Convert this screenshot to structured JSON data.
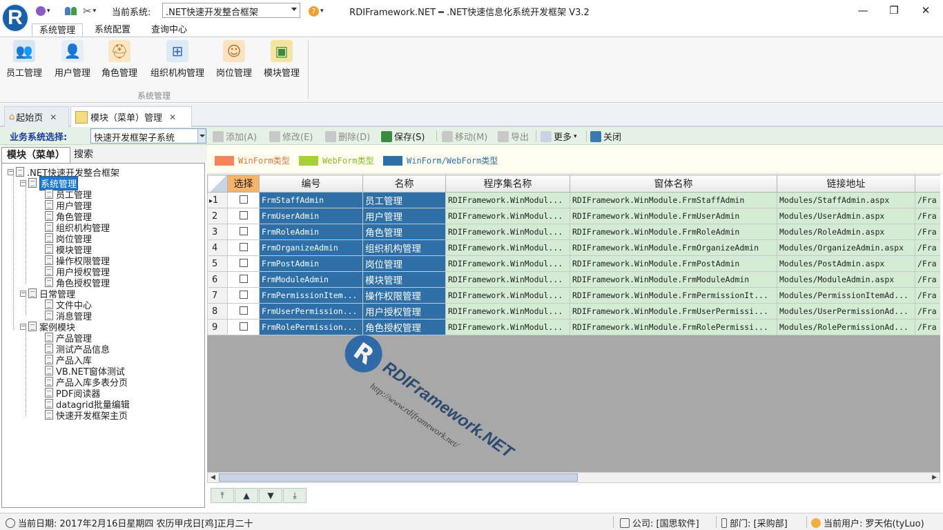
{
  "titlebar": {
    "system_label": "当前系统:",
    "system_value": ".NET快速开发整合框架",
    "window_title": "RDIFramework.NET ━ .NET快速信息化系统开发框架 V3.2",
    "logo_letter": "R",
    "minimize": "—",
    "restore": "❐",
    "close": "✕"
  },
  "ribbon": {
    "tabs": [
      "系统管理",
      "系统配置",
      "查询中心"
    ],
    "buttons": [
      {
        "label": "员工管理",
        "icon": "staff-icon"
      },
      {
        "label": "用户管理",
        "icon": "user-icon"
      },
      {
        "label": "角色管理",
        "icon": "role-icon"
      },
      {
        "label": "组织机构管理",
        "icon": "org-icon"
      },
      {
        "label": "岗位管理",
        "icon": "post-icon"
      },
      {
        "label": "模块管理",
        "icon": "module-icon"
      }
    ],
    "group_label": "系统管理"
  },
  "doctabs": [
    {
      "label": "起始页",
      "close": "✕"
    },
    {
      "label": "模块（菜单）管理",
      "close": "✕"
    }
  ],
  "toolbar": {
    "biz_label": "业务系统选择:",
    "biz_value": "快速开发框架子系统",
    "add": "添加(A)",
    "edit": "修改(E)",
    "delete": "删除(D)",
    "save": "保存(S)",
    "move": "移动(M)",
    "export": "导出",
    "more": "更多",
    "close": "关闭"
  },
  "left_tabs": [
    "模块（菜单）",
    "搜索"
  ],
  "tree": {
    "root": ".NET快速开发整合框架",
    "groups": [
      {
        "label": "系统管理",
        "items": [
          "员工管理",
          "用户管理",
          "角色管理",
          "组织机构管理",
          "岗位管理",
          "模块管理",
          "操作权限管理",
          "用户授权管理",
          "角色授权管理"
        ]
      },
      {
        "label": "日常管理",
        "items": [
          "文件中心",
          "消息管理"
        ]
      },
      {
        "label": "案例模块",
        "items": [
          "产品管理",
          "测试产品信息",
          "产品入库",
          "VB.NET窗体测试",
          "产品入库多表分页",
          "PDF阅读器",
          "datagrid批量编辑",
          "快速开发框架主页"
        ]
      }
    ]
  },
  "legend": [
    {
      "label": "WinForm类型",
      "color": "#f5845a",
      "text_color": "#e8743a"
    },
    {
      "label": "WebForm类型",
      "color": "#a6cf38",
      "text_color": "#8cb820"
    },
    {
      "label": "WinForm/WebForm类型",
      "color": "#2e6fa8",
      "text_color": "#2e6fa8"
    }
  ],
  "grid": {
    "columns": [
      "",
      "选择",
      "编号",
      "名称",
      "程序集名称",
      "窗体名称",
      "链接地址",
      ""
    ],
    "rows": [
      {
        "no": "1",
        "code": "FrmStaffAdmin",
        "name": "员工管理",
        "assembly": "RDIFramework.WinModul...",
        "form": "RDIFramework.WinModule.FrmStaffAdmin",
        "url": "Modules/StaffAdmin.aspx",
        "extra": "/Fra"
      },
      {
        "no": "2",
        "code": "FrmUserAdmin",
        "name": "用户管理",
        "assembly": "RDIFramework.WinModul...",
        "form": "RDIFramework.WinModule.FrmUserAdmin",
        "url": "Modules/UserAdmin.aspx",
        "extra": "/Fra"
      },
      {
        "no": "3",
        "code": "FrmRoleAdmin",
        "name": "角色管理",
        "assembly": "RDIFramework.WinModul...",
        "form": "RDIFramework.WinModule.FrmRoleAdmin",
        "url": "Modules/RoleAdmin.aspx",
        "extra": "/Fra"
      },
      {
        "no": "4",
        "code": "FrmOrganizeAdmin",
        "name": "组织机构管理",
        "assembly": "RDIFramework.WinModul...",
        "form": "RDIFramework.WinModule.FrmOrganizeAdmin",
        "url": "Modules/OrganizeAdmin.aspx",
        "extra": "/Fra"
      },
      {
        "no": "5",
        "code": "FrmPostAdmin",
        "name": "岗位管理",
        "assembly": "RDIFramework.WinModul...",
        "form": "RDIFramework.WinModule.FrmPostAdmin",
        "url": "Modules/PostAdmin.aspx",
        "extra": "/Fra"
      },
      {
        "no": "6",
        "code": "FrmModuleAdmin",
        "name": "模块管理",
        "assembly": "RDIFramework.WinModul...",
        "form": "RDIFramework.WinModule.FrmModuleAdmin",
        "url": "Modules/ModuleAdmin.aspx",
        "extra": "/Fra"
      },
      {
        "no": "7",
        "code": "FrmPermissionItem...",
        "name": "操作权限管理",
        "assembly": "RDIFramework.WinModul...",
        "form": "RDIFramework.WinModule.FrmPermissionIt...",
        "url": "Modules/PermissionItemAd...",
        "extra": "/Fra"
      },
      {
        "no": "8",
        "code": "FrmUserPermission...",
        "name": "用户授权管理",
        "assembly": "RDIFramework.WinModul...",
        "form": "RDIFramework.WinModule.FrmUserPermissi...",
        "url": "Modules/UserPermissionAd...",
        "extra": "/Fra"
      },
      {
        "no": "9",
        "code": "FrmRolePermission...",
        "name": "角色授权管理",
        "assembly": "RDIFramework.WinModul...",
        "form": "RDIFramework.WinModule.FrmRolePermissi...",
        "url": "Modules/RolePermissionAd...",
        "extra": "/Fra"
      }
    ]
  },
  "watermark": {
    "letter": "R",
    "brand": "RDIFramework.NET",
    "url": "http://www.rdiframework.net/"
  },
  "nav": [
    "⤒",
    "▲",
    "▼",
    "⤓"
  ],
  "statusbar": {
    "date": "当前日期: 2017年2月16日星期四 农历甲戌日[鸡]正月二十",
    "company": "公司: [国思软件]",
    "department": "部门: [采购部]",
    "user": "当前用户: 罗天佑(tyLuo)"
  }
}
